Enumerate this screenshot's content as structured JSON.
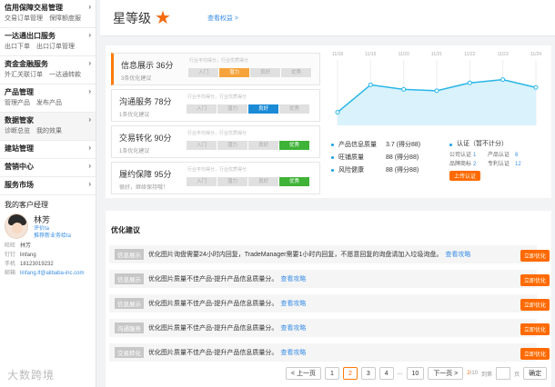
{
  "sidebar": {
    "sections": [
      {
        "title": "信用保障交易管理",
        "links": [
          "交易订单管理",
          "保障额度服"
        ]
      },
      {
        "title": "一达通出口服务",
        "links": [
          "出口下单",
          "出口订单管理"
        ]
      },
      {
        "title": "资金金融服务",
        "links": [
          "外汇关联订单",
          "一达通转款"
        ]
      },
      {
        "title": "产品管理",
        "links": [
          "管理产品",
          "发布产品"
        ]
      },
      {
        "title": "数据管家",
        "links": [
          "诊断总览",
          "我的效果"
        ]
      },
      {
        "title": "建站管理",
        "links": []
      },
      {
        "title": "营销中心",
        "links": []
      },
      {
        "title": "服务市场",
        "links": []
      }
    ],
    "manager": {
      "heading": "我的客户经理",
      "name": "林芳",
      "role1": "评价ta",
      "role2": "推荐新业务给ta",
      "rows": [
        {
          "k": "旺旺",
          "v": "林芳"
        },
        {
          "k": "钉钉",
          "v": "linfang"
        },
        {
          "k": "手机",
          "v": "18123019232"
        },
        {
          "k": "邮箱",
          "v": "linfang.lf@alibaba-inc.com"
        }
      ]
    }
  },
  "header": {
    "level": "星等级",
    "link": "查看权益 >"
  },
  "cards": [
    {
      "title": "信息展示",
      "score": "36分",
      "sub": "3条优化建议",
      "meta": "行业平均得分，行业优质得分",
      "segs": [
        "入门",
        "潜力",
        "良好",
        "优秀"
      ],
      "active": 1,
      "color": "or"
    },
    {
      "title": "沟通服务",
      "score": "78分",
      "sub": "1条优化建议",
      "meta": "行业平均得分，行业优质得分",
      "segs": [
        "入门",
        "潜力",
        "良好",
        "优秀"
      ],
      "active": 2,
      "color": "bl"
    },
    {
      "title": "交易转化",
      "score": "90分",
      "sub": "1条优化建议",
      "meta": "行业平均得分，行业优质得分",
      "segs": [
        "入门",
        "潜力",
        "良好",
        "优秀"
      ],
      "active": 3,
      "color": "gr"
    },
    {
      "title": "履约保障",
      "score": "95分",
      "sub": "很好，继续保持哦！",
      "meta": "行业平均得分，行业优质得分",
      "segs": [
        "入门",
        "潜力",
        "良好",
        "优秀"
      ],
      "active": 3,
      "color": "gr"
    }
  ],
  "chart_data": {
    "type": "line",
    "x": [
      "11/18",
      "11/19",
      "11/20",
      "11/21",
      "11/22",
      "11/23",
      "11/24"
    ],
    "series": [
      {
        "values": [
          20,
          62,
          55,
          53,
          65,
          70,
          58
        ]
      }
    ],
    "ylim": [
      0,
      100
    ],
    "color": "#29b6e8",
    "grid": true
  },
  "stats": [
    {
      "label": "产品信息质量",
      "value": "3.7 (得分88)"
    },
    {
      "label": "旺铺质量",
      "value": "88 (得分88)"
    },
    {
      "label": "风险健康",
      "value": "88 (得分88)"
    }
  ],
  "cert": {
    "title": "认证（暂不计分）",
    "items": [
      {
        "k": "公司认证",
        "v": "1"
      },
      {
        "k": "产品认证",
        "v": "8"
      },
      {
        "k": "品牌商标",
        "v": "2"
      },
      {
        "k": "专利认证",
        "v": "12"
      }
    ],
    "button": "上传认证"
  },
  "optimization": {
    "title": "优化建议",
    "rows": [
      {
        "tag": "信息展示",
        "text": "优化图片询盘需要24小时内回复，TradeManager需要1小时内回复，不愿意回复的询盘请加入垃圾询盘。",
        "link": "查看攻略",
        "button": "立即优化"
      },
      {
        "tag": "信息展示",
        "text": "优化图片质量不佳产品-提升产品信息质量分。",
        "link": "查看攻略",
        "button": "立即优化"
      },
      {
        "tag": "信息展示",
        "text": "优化图片质量不佳产品-提升产品信息质量分。",
        "link": "查看攻略",
        "button": "立即优化"
      },
      {
        "tag": "沟通服务",
        "text": "优化图片质量不佳产品-提升产品信息质量分。",
        "link": "查看攻略",
        "button": "立即优化"
      },
      {
        "tag": "交易转化",
        "text": "优化图片质量不佳产品-提升产品信息质量分。",
        "link": "查看攻略",
        "button": "立即优化"
      }
    ]
  },
  "pagination": {
    "prev": "< 上一页",
    "pages": [
      "1",
      "2",
      "3",
      "4",
      "...",
      "10"
    ],
    "current": "2",
    "next": "下一页 >",
    "info_cur": "2",
    "info_total": "/10",
    "goto": "到第",
    "page_unit": "页",
    "confirm": "确定"
  },
  "watermark": "大数跨境"
}
